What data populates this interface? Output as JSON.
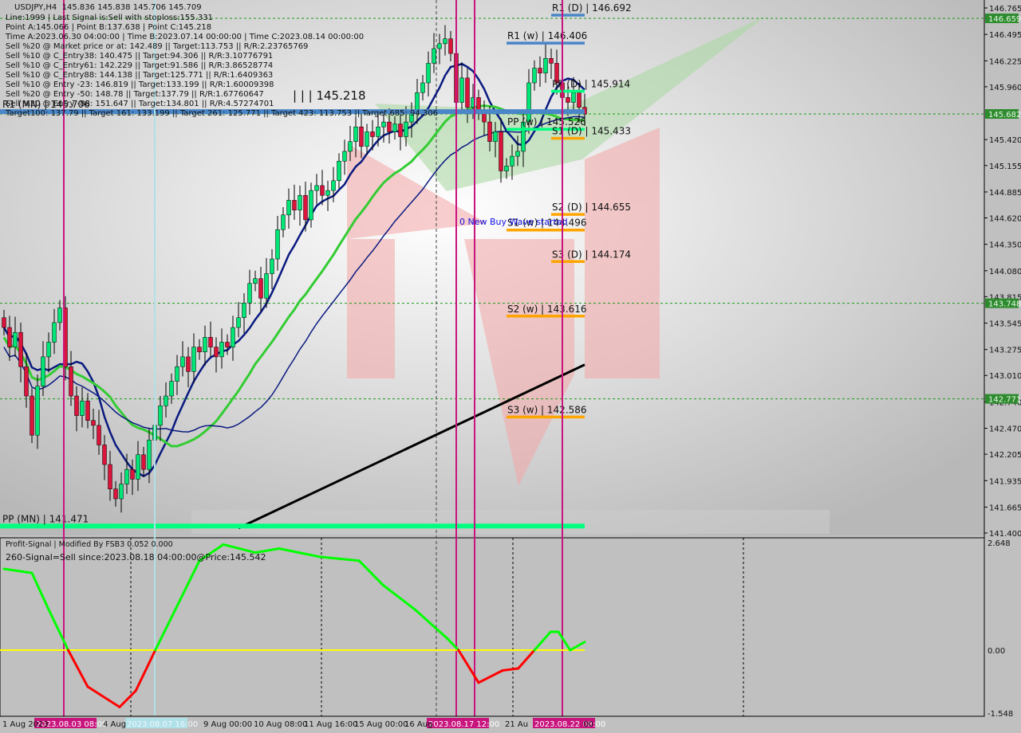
{
  "header": {
    "symbol": "USDJPY,H4",
    "ohlc": "145.836 145.838 145.706 145.709"
  },
  "info_lines": [
    "Line:1999 | Last Signal is:Sell with stoploss:155.331",
    "Point A:145.066 | Point B:137.638 | Point C:145.218",
    "Time A:2023.06.30 04:00:00 | Time B:2023.07.14 00:00:00 | Time C:2023.08.14 00:00:00",
    "Sell %20 @ Market price or at: 142.489 || Target:113.753 || R/R:2.23765769",
    "Sell %10 @ C_Entry38: 140.475 || Target:94.306 || R/R:3.10776791",
    "Sell %10 @ C_Entry61: 142.229 || Target:91.586 || R/R:3.86528774",
    "Sell %10 @ C_Entry88: 144.138 || Target:125.771 || R/R:1.6409363",
    "Sell %10 @ Entry -23: 146.819 || Target:133.199 || R/R:1.60009398",
    "Sell %20 @ Entry -50: 148.78 || Target:137.79 || R/R:1.67760647",
    "Sell %20 @ Entry -88: 151.647 || Target:134.801 || R/R:4.57274701",
    "Target100: 137.79 || Target 161: 133.199 || Target 261: 125.771 || Target 423: 113.753 || Target 685: 94.306"
  ],
  "point_c_label": "| | | 145.218",
  "wave_label": "0 New Buy Wave started",
  "indicator": {
    "title": "Profit-Signal | Modified By FSB3 0.052 0.000",
    "signal": "260-Signal=Sell since:2023.08.18 04:00:00@Price:145.542",
    "ticks": [
      "2.648",
      "0.00",
      "-1.548"
    ],
    "range": [
      -1.548,
      2.648
    ],
    "values": [
      [
        0,
        2.0
      ],
      [
        5,
        1.9
      ],
      [
        8,
        1.0
      ],
      [
        11.5,
        0
      ],
      [
        15,
        -0.9
      ],
      [
        20.7,
        -1.4
      ],
      [
        23.6,
        -1.0
      ],
      [
        27.1,
        0
      ],
      [
        30.7,
        1.0
      ],
      [
        35,
        2.2
      ],
      [
        39.3,
        2.6
      ],
      [
        45,
        2.4
      ],
      [
        49.3,
        2.5
      ],
      [
        56.4,
        2.3
      ],
      [
        63.6,
        2.2
      ],
      [
        67.9,
        1.6
      ],
      [
        73.6,
        1.0
      ],
      [
        79.3,
        0.3
      ],
      [
        81.4,
        0
      ],
      [
        85,
        -0.8
      ],
      [
        89.3,
        -0.5
      ],
      [
        92.1,
        -0.45
      ],
      [
        95,
        0
      ],
      [
        97.9,
        0.45
      ],
      [
        99.3,
        0.45
      ],
      [
        101.4,
        0
      ],
      [
        104,
        0.2
      ]
    ],
    "pos_color": "#00ff00",
    "neg_color": "#ff0000",
    "zero_color": "#ffff00"
  },
  "chart_data": {
    "type": "candlestick",
    "symbol": "USDJPY",
    "timeframe": "H4",
    "ylim": [
      141.4,
      146.765
    ],
    "y_ticks": [
      "146.765",
      "146.495",
      "146.225",
      "145.960",
      "145.420",
      "145.155",
      "144.885",
      "144.620",
      "144.350",
      "144.080",
      "143.815",
      "143.545",
      "143.275",
      "143.010",
      "142.740",
      "142.470",
      "142.205",
      "141.935",
      "141.665",
      "141.400"
    ],
    "price_tags": [
      {
        "value": "146.659",
        "color": "#2e8b2e"
      },
      {
        "value": "145.682",
        "color": "#2e8b2e"
      },
      {
        "value": "143.748",
        "color": "#2e8b2e"
      },
      {
        "value": "142.771",
        "color": "#2e8b2e"
      }
    ],
    "x_labels": [
      "1 Aug 2023",
      "4 Aug",
      "9 Aug 00:00",
      "10 Aug 08:00",
      "11 Aug 16:00",
      "15 Aug 00:00",
      "16 Aug",
      "21 Au",
      "00"
    ],
    "x_label_index": [
      0,
      18,
      36,
      45,
      54,
      63,
      72,
      90,
      104
    ],
    "vline_labels": [
      {
        "text": "2023.08.03 08:00",
        "index": 11,
        "color": "#c8157e"
      },
      {
        "text": "2023.08.07 16:00",
        "index": 27,
        "color": "#b0e0e8"
      },
      {
        "text": "2023.08.17 12:00",
        "index": 81,
        "color": "#c8157e"
      },
      {
        "text": "2023.08.22 08:00",
        "index": 100,
        "color": "#c8157e"
      }
    ],
    "closes": [
      143.5,
      143.3,
      143.45,
      143.1,
      142.8,
      142.4,
      142.9,
      143.2,
      143.35,
      143.55,
      143.7,
      143.1,
      142.8,
      142.6,
      142.75,
      142.55,
      142.5,
      142.3,
      142.1,
      141.85,
      141.75,
      141.9,
      142.05,
      141.95,
      142.2,
      142.05,
      142.35,
      142.5,
      142.7,
      142.8,
      142.95,
      143.1,
      143.2,
      143.05,
      143.3,
      143.25,
      143.4,
      143.3,
      143.2,
      143.35,
      143.3,
      143.5,
      143.6,
      143.75,
      143.95,
      144.0,
      143.8,
      144.05,
      144.2,
      144.5,
      144.65,
      144.8,
      144.7,
      144.85,
      144.6,
      144.9,
      144.95,
      144.85,
      144.9,
      145.0,
      145.2,
      145.3,
      145.4,
      145.55,
      145.35,
      145.5,
      145.45,
      145.55,
      145.6,
      145.5,
      145.58,
      145.45,
      145.6,
      145.7,
      145.9,
      146.0,
      146.2,
      146.35,
      146.4,
      146.45,
      146.3,
      145.8,
      146.05,
      145.75,
      145.85,
      145.7,
      145.6,
      145.4,
      145.5,
      145.1,
      145.15,
      145.25,
      145.3,
      145.6,
      146.0,
      146.15,
      146.1,
      146.25,
      146.2,
      146.0,
      145.85,
      145.8,
      145.9,
      145.75,
      145.68
    ],
    "up_color": "#00e676",
    "down_color": "#dc143c",
    "ma200": [
      [
        42,
        141.45
      ],
      [
        104,
        143.12
      ]
    ],
    "levels": [
      {
        "label": "R1 (D) | 146.692",
        "value": 146.692,
        "from": 98,
        "color": "#4a86c8"
      },
      {
        "label": "R1 (w) | 146.406",
        "value": 146.406,
        "from": 90,
        "color": "#4a86c8"
      },
      {
        "label": "PP (D) | 145.914",
        "value": 145.914,
        "from": 98,
        "color": "#00ff80"
      },
      {
        "label": "PP (w) | 145.526",
        "value": 145.526,
        "from": 90,
        "color": "#00ff80"
      },
      {
        "label": "S1 (D) | 145.433",
        "value": 145.433,
        "from": 98,
        "color": "#ffa500"
      },
      {
        "label": "S2 (D) | 144.655",
        "value": 144.655,
        "from": 98,
        "color": "#ffa500"
      },
      {
        "label": "S1 (w) | 144.496",
        "value": 144.496,
        "from": 90,
        "color": "#ffa500"
      },
      {
        "label": "S3 (D) | 144.174",
        "value": 144.174,
        "from": 98,
        "color": "#ffa500"
      },
      {
        "label": "S2 (w) | 143.616",
        "value": 143.616,
        "from": 90,
        "color": "#ffa500"
      },
      {
        "label": "S3 (w) | 142.586",
        "value": 142.586,
        "from": 90,
        "color": "#ffa500"
      },
      {
        "label": "R1 (MN) | 145.706",
        "value": 145.706,
        "from": 0,
        "color": "#4a86c8"
      },
      {
        "label": "PP (MN) | 141.471",
        "value": 141.471,
        "from": 0,
        "color": "#00ff80"
      }
    ],
    "hlines": [
      146.659,
      145.682,
      143.748,
      142.771
    ]
  }
}
